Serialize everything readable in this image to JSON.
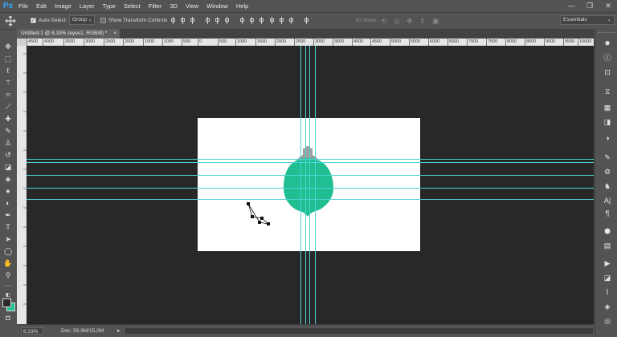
{
  "app": {
    "logo": "Ps"
  },
  "menu": [
    "File",
    "Edit",
    "Image",
    "Layer",
    "Type",
    "Select",
    "Filter",
    "3D",
    "View",
    "Window",
    "Help"
  ],
  "window_controls": {
    "minimize": "—",
    "restore": "❐",
    "close": "✕"
  },
  "options_bar": {
    "auto_select_label": "Auto-Select:",
    "auto_select_checked": true,
    "group_value": "Group",
    "show_transform_label": "Show Transform Controls",
    "show_transform_checked": false,
    "mode_3d_label": "3D Mode:",
    "workspace_value": "Essentials"
  },
  "document": {
    "tab_title": "Untitled-1 @ 8,33% (eyes1, RGB/8) *",
    "tab_close": "×"
  },
  "ruler_labels": [
    "4500",
    "4000",
    "3500",
    "3000",
    "2500",
    "2000",
    "1500",
    "1000",
    "500",
    "0",
    "500",
    "1000",
    "1500",
    "2000",
    "2500",
    "3000",
    "3500",
    "4000",
    "4500",
    "5000",
    "5500",
    "6000",
    "6500",
    "7000",
    "7500",
    "8000",
    "8500",
    "9000",
    "9500",
    "10000"
  ],
  "colors": {
    "ui_bg": "#535353",
    "pasteboard": "#282828",
    "guide": "#4fd3d6",
    "shape_green": "#1fbf91",
    "shape_gray": "#9e9e9e",
    "foreground_color": "#2a2a2a",
    "background_color": "#1fbf91"
  },
  "tools": [
    "move-icon",
    "marquee-icon",
    "lasso-icon",
    "magic-wand-icon",
    "crop-icon",
    "eyedropper-icon",
    "healing-icon",
    "brush-icon",
    "clone-stamp-icon",
    "history-brush-icon",
    "eraser-icon",
    "paint-bucket-icon",
    "blur-icon",
    "dodge-icon",
    "pen-icon",
    "type-icon",
    "path-select-icon",
    "ellipse-icon",
    "hand-icon",
    "zoom-icon",
    "more-tools-icon"
  ],
  "status": {
    "zoom": "8,33%",
    "doc_info": "Doc: 59,9M/15,0M"
  }
}
